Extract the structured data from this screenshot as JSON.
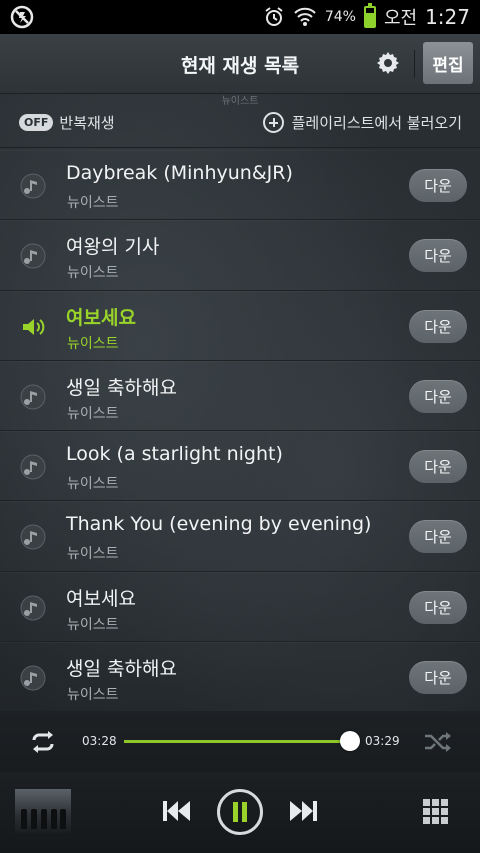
{
  "status_bar": {
    "battery_percent_text": "74%",
    "battery_level": 0.74,
    "ampm": "오전",
    "time": "1:27",
    "accent": "#8dd12c"
  },
  "header": {
    "title": "현재 재생 목록",
    "edit_label": "편집",
    "sub_text": "뉴이스트"
  },
  "options": {
    "repeat_state": "OFF",
    "repeat_label": "반복재생",
    "load_playlist_label": "플레이리스트에서 불러오기"
  },
  "tracks": [
    {
      "title": "Daybreak (Minhyun&JR)",
      "artist": "뉴이스트",
      "button": "다운",
      "active": false
    },
    {
      "title": "여왕의 기사",
      "artist": "뉴이스트",
      "button": "다운",
      "active": false
    },
    {
      "title": "여보세요",
      "artist": "뉴이스트",
      "button": "다운",
      "active": true
    },
    {
      "title": "생일 축하해요",
      "artist": "뉴이스트",
      "button": "다운",
      "active": false
    },
    {
      "title": "Look (a starlight night)",
      "artist": "뉴이스트",
      "button": "다운",
      "active": false
    },
    {
      "title": "Thank You (evening by evening)",
      "artist": "뉴이스트",
      "button": "다운",
      "active": false
    },
    {
      "title": "여보세요",
      "artist": "뉴이스트",
      "button": "다운",
      "active": false
    },
    {
      "title": "생일 축하해요",
      "artist": "뉴이스트",
      "button": "다운",
      "active": false
    }
  ],
  "player": {
    "elapsed": "03:28",
    "duration": "03:29",
    "progress": 0.99,
    "state": "playing",
    "accent": "#8fc62a"
  }
}
